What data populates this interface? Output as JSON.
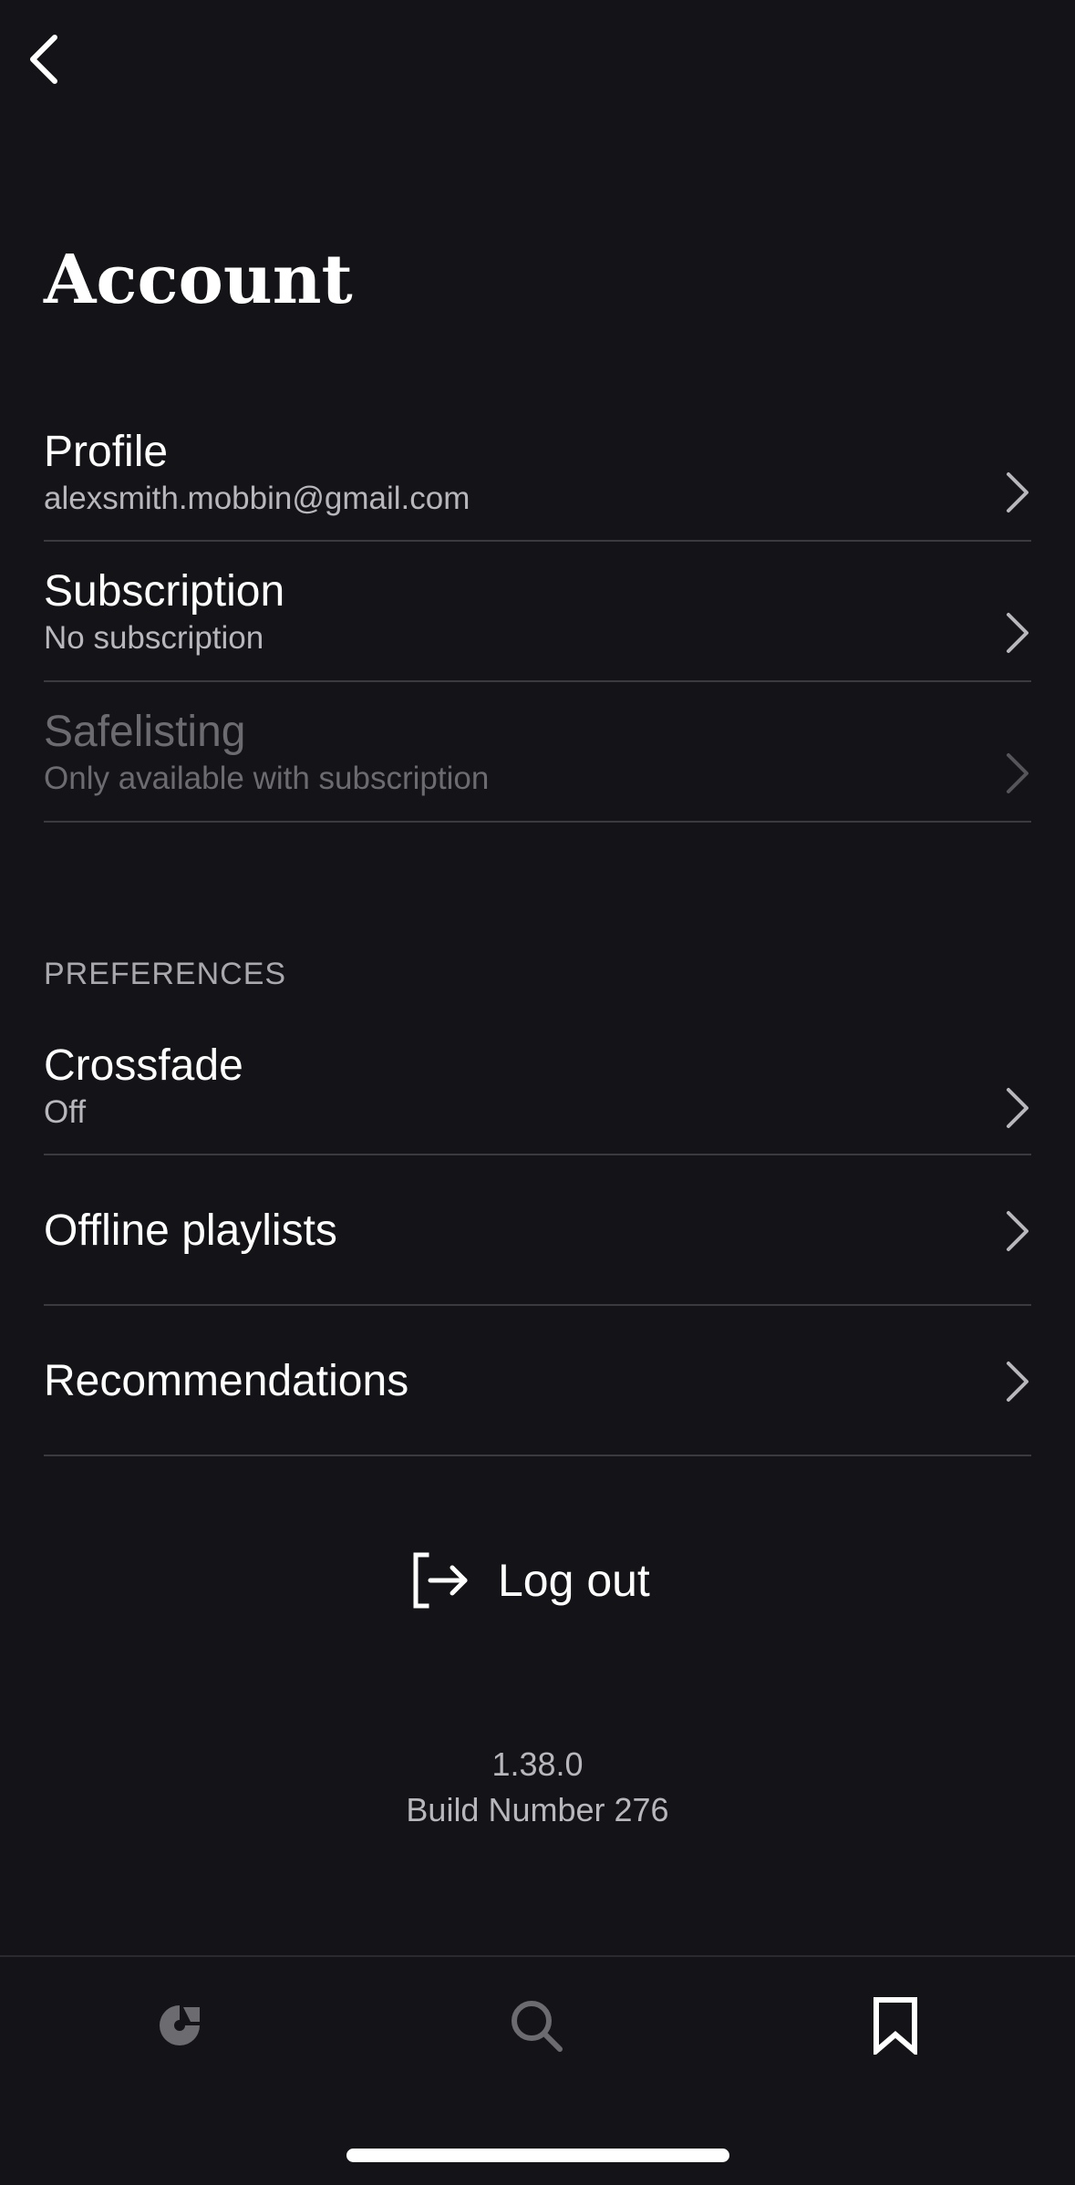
{
  "header": {
    "back_icon": "chevron-left-icon",
    "title": "Account"
  },
  "account_items": [
    {
      "title": "Profile",
      "subtitle": "alexsmith.mobbin@gmail.com",
      "enabled": true
    },
    {
      "title": "Subscription",
      "subtitle": "No subscription",
      "enabled": true
    },
    {
      "title": "Safelisting",
      "subtitle": "Only available with subscription",
      "enabled": false
    }
  ],
  "preferences": {
    "header": "PREFERENCES",
    "items": [
      {
        "title": "Crossfade",
        "subtitle": "Off"
      },
      {
        "title": "Offline playlists"
      },
      {
        "title": "Recommendations"
      }
    ]
  },
  "logout": {
    "label": "Log out",
    "icon": "logout-icon"
  },
  "version": {
    "number": "1.38.0",
    "build": "Build Number 276"
  },
  "tab_bar": {
    "tabs": [
      {
        "icon": "home-icon",
        "active": false
      },
      {
        "icon": "search-icon",
        "active": false
      },
      {
        "icon": "bookmark-icon",
        "active": true
      }
    ]
  },
  "colors": {
    "background": "#141418",
    "text_primary": "#ffffff",
    "text_secondary": "#b7b7bc",
    "text_disabled": "#6b6b70",
    "divider": "#3a3a40",
    "tab_inactive": "#6b6b70"
  }
}
